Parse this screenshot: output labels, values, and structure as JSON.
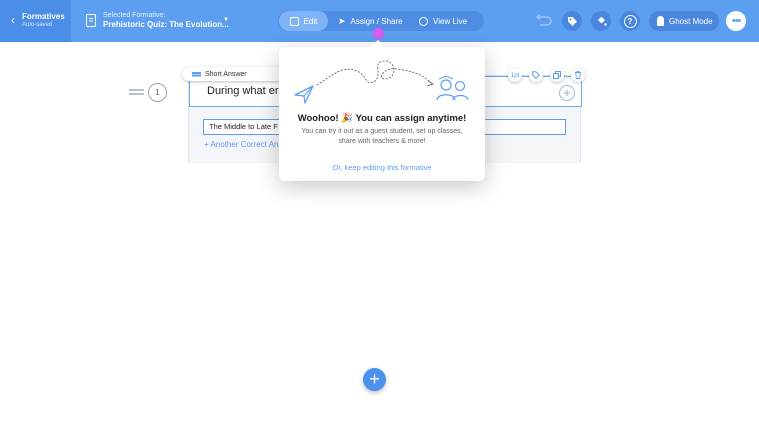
{
  "topbar": {
    "back": {
      "title": "Formatives",
      "subtitle": "Auto-saved"
    },
    "selected": {
      "label": "Selected Formative:",
      "name": "Prehistoric Quiz: The Evolution..."
    },
    "tabs": [
      {
        "label": "Edit",
        "icon": "document-icon",
        "active": true
      },
      {
        "label": "Assign / Share",
        "icon": "paper-plane-icon",
        "active": false
      },
      {
        "label": "View Live",
        "icon": "chat-icon",
        "active": false
      }
    ],
    "ghost_mode": "Ghost Mode",
    "more": "•••"
  },
  "question": {
    "number": "1",
    "type_label": "Short Answer",
    "text": "During what era",
    "answer_value": "The Middle to Late F",
    "another_answer": "+ Another Correct Ans",
    "points": "1pt"
  },
  "popover": {
    "title": "Woohoo! 🎉 You can assign anytime!",
    "text": "You can try it out as a guest student, set up classes, share with teachers & more!",
    "link": "Or, keep editing this formative"
  },
  "colors": {
    "primary": "#5c9ef0",
    "topbar_dark": "#4a86dd",
    "accent_pink": "#d05ef0"
  }
}
